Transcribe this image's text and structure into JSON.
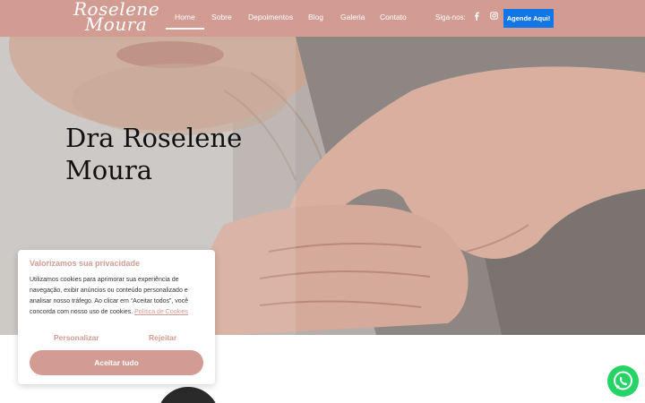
{
  "header": {
    "logo_line1": "Roselene",
    "logo_line2": "Moura",
    "nav": [
      "Home",
      "Sobre",
      "Depoimentos",
      "Blog",
      "Galeria",
      "Contato"
    ],
    "social_label": "Siga-nos:",
    "social_icons": [
      "facebook-icon",
      "instagram-icon"
    ],
    "cta_label": "Agende Aqui!"
  },
  "hero": {
    "title_line1": "Dra Roselene",
    "title_line2": "Moura"
  },
  "cookie": {
    "title": "Valorizamos sua privacidade",
    "text": "Utilizamos cookies para aprimorar sua experiência de navegação, exibir anúncios ou conteúdo personalizado e analisar nosso tráfego. Ao clicar em “Aceitar todos”, você concorda com nosso uso de cookies.",
    "link": "Política de Cookies",
    "customize": "Personalizar",
    "reject": "Rejeitar",
    "accept": "Aceitar tudo"
  },
  "colors": {
    "brand": "#d29c93",
    "cta": "#1177e8",
    "whatsapp": "#25d366"
  }
}
